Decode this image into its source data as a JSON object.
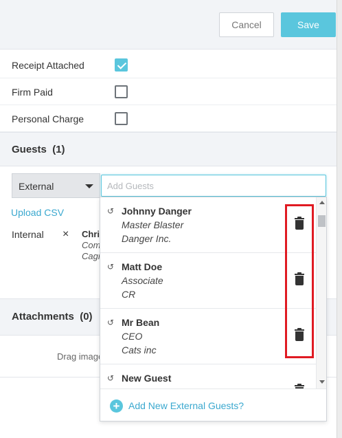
{
  "header": {
    "cancel_label": "Cancel",
    "save_label": "Save"
  },
  "options": [
    {
      "label": "Receipt Attached",
      "checked": true
    },
    {
      "label": "Firm Paid",
      "checked": false
    },
    {
      "label": "Personal Charge",
      "checked": false
    }
  ],
  "guests": {
    "title": "Guests",
    "count": "(1)",
    "type_select": "External",
    "input_placeholder": "Add Guests",
    "upload_csv": "Upload CSV",
    "internal_label": "Internal",
    "remove_icon": "×",
    "internal_name": "Chris",
    "internal_line1": "Company",
    "internal_line2": "Cagney"
  },
  "dropdown": {
    "items": [
      {
        "name": "Johnny Danger",
        "line1": "Master Blaster",
        "line2": "Danger Inc."
      },
      {
        "name": "Matt Doe",
        "line1": "Associate",
        "line2": "CR"
      },
      {
        "name": "Mr Bean",
        "line1": "CEO",
        "line2": "Cats inc"
      },
      {
        "name": "New Guest",
        "line1": "",
        "line2": ""
      }
    ],
    "history_icon": "history-icon",
    "trash_icon": "trash-icon",
    "add_new_label": "Add New External Guests?"
  },
  "attachments": {
    "title": "Attachments",
    "count": "(0)",
    "drag_text": "Drag images here"
  },
  "colors": {
    "accent": "#5ac6dd",
    "link": "#3aa8cf",
    "highlight": "#e01a22"
  }
}
